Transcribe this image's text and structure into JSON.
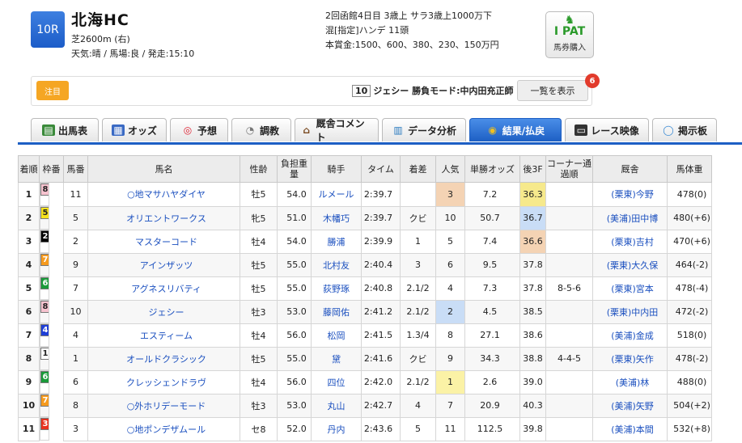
{
  "race": {
    "number": "10R",
    "name": "北海HC",
    "course": "芝2600m (右)",
    "conditions": "天気:晴 / 馬場:良 / 発走:15:10",
    "meta_line1": "2回函館4日目 3歳上 サラ3歳上1000万下",
    "meta_line2": "混[指定]ハンデ 11頭",
    "meta_line3": "本賞金:1500、600、380、230、150万円"
  },
  "ipat": {
    "icon": "horse-rider-icon",
    "title": "I PAT",
    "label": "馬券購入"
  },
  "notice": {
    "tag": "注目",
    "number": "10",
    "text": "ジェシー 勝負モード:中内田充正師",
    "button": "一覧を表示",
    "badge": "6"
  },
  "tabs": [
    {
      "label": "出馬表",
      "icon": "entry-table-icon"
    },
    {
      "label": "オッズ",
      "icon": "odds-chart-icon"
    },
    {
      "label": "予想",
      "icon": "target-icon"
    },
    {
      "label": "調教",
      "icon": "stopwatch-icon"
    },
    {
      "label": "厩舎コメント",
      "icon": "stable-house-icon"
    },
    {
      "label": "データ分析",
      "icon": "bar-chart-icon"
    },
    {
      "label": "結果/払戻",
      "icon": "coins-icon",
      "active": true
    },
    {
      "label": "レース映像",
      "icon": "film-icon"
    },
    {
      "label": "掲示板",
      "icon": "speech-bubble-icon"
    }
  ],
  "columns": [
    "着順",
    "枠番",
    "馬番",
    "馬名",
    "性齢",
    "負担重量",
    "騎手",
    "タイム",
    "着差",
    "人気",
    "単勝オッズ",
    "後3F",
    "コーナー通過順",
    "厩舎",
    "馬体重"
  ],
  "colors": {
    "waku1": "#ffffff",
    "waku2": "#000000",
    "waku3": "#e8311f",
    "waku4": "#1f3fd6",
    "waku5": "#f6e21c",
    "waku6": "#1a9a3a",
    "waku7": "#f59a1e",
    "waku8": "#f7c3cf"
  },
  "rows": [
    {
      "pos": "1",
      "waku": "8",
      "num": "11",
      "horse": "○地マサハヤダイヤ",
      "sex_age": "牡5",
      "weight": "54.0",
      "jockey": "ルメール",
      "time": "2:39.7",
      "margin": "",
      "pop": "3",
      "odds": "7.2",
      "last3f": "36.3",
      "corner": "",
      "trainer": "(栗東)今野",
      "body": "478(0)"
    },
    {
      "pos": "2",
      "waku": "5",
      "num": "5",
      "horse": "オリエントワークス",
      "sex_age": "牝5",
      "weight": "51.0",
      "jockey": "木幡巧",
      "time": "2:39.7",
      "margin": "クビ",
      "pop": "10",
      "odds": "50.7",
      "last3f": "36.7",
      "corner": "",
      "trainer": "(美浦)田中博",
      "body": "480(+6)"
    },
    {
      "pos": "3",
      "waku": "2",
      "num": "2",
      "horse": "マスターコード",
      "sex_age": "牡4",
      "weight": "54.0",
      "jockey": "勝浦",
      "time": "2:39.9",
      "margin": "1",
      "pop": "5",
      "odds": "7.4",
      "last3f": "36.6",
      "corner": "",
      "trainer": "(栗東)吉村",
      "body": "470(+6)"
    },
    {
      "pos": "4",
      "waku": "7",
      "num": "9",
      "horse": "アインザッツ",
      "sex_age": "牡5",
      "weight": "55.0",
      "jockey": "北村友",
      "time": "2:40.4",
      "margin": "3",
      "pop": "6",
      "odds": "9.5",
      "last3f": "37.8",
      "corner": "",
      "trainer": "(栗東)大久保",
      "body": "464(-2)"
    },
    {
      "pos": "5",
      "waku": "6",
      "num": "7",
      "horse": "アグネスリバティ",
      "sex_age": "牡5",
      "weight": "55.0",
      "jockey": "荻野琢",
      "time": "2:40.8",
      "margin": "2.1/2",
      "pop": "4",
      "odds": "7.3",
      "last3f": "37.8",
      "corner": "8-5-6",
      "trainer": "(栗東)宮本",
      "body": "478(-4)"
    },
    {
      "pos": "6",
      "waku": "8",
      "num": "10",
      "horse": "ジェシー",
      "sex_age": "牡3",
      "weight": "53.0",
      "jockey": "藤岡佑",
      "time": "2:41.2",
      "margin": "2.1/2",
      "pop": "2",
      "odds": "4.5",
      "last3f": "38.5",
      "corner": "",
      "trainer": "(栗東)中内田",
      "body": "472(-2)"
    },
    {
      "pos": "7",
      "waku": "4",
      "num": "4",
      "horse": "エスティーム",
      "sex_age": "牡4",
      "weight": "56.0",
      "jockey": "松岡",
      "time": "2:41.5",
      "margin": "1.3/4",
      "pop": "8",
      "odds": "27.1",
      "last3f": "38.6",
      "corner": "",
      "trainer": "(美浦)金成",
      "body": "518(0)"
    },
    {
      "pos": "8",
      "waku": "1",
      "num": "1",
      "horse": "オールドクラシック",
      "sex_age": "牡5",
      "weight": "55.0",
      "jockey": "黛",
      "time": "2:41.6",
      "margin": "クビ",
      "pop": "9",
      "odds": "34.3",
      "last3f": "38.8",
      "corner": "4-4-5",
      "trainer": "(栗東)矢作",
      "body": "478(-2)"
    },
    {
      "pos": "9",
      "waku": "6",
      "num": "6",
      "horse": "クレッシェンドラヴ",
      "sex_age": "牡4",
      "weight": "56.0",
      "jockey": "四位",
      "time": "2:42.0",
      "margin": "2.1/2",
      "pop": "1",
      "odds": "2.6",
      "last3f": "39.0",
      "corner": "",
      "trainer": "(美浦)林",
      "body": "488(0)"
    },
    {
      "pos": "10",
      "waku": "7",
      "num": "8",
      "horse": "○外ホリデーモード",
      "sex_age": "牡3",
      "weight": "53.0",
      "jockey": "丸山",
      "time": "2:42.7",
      "margin": "4",
      "pop": "7",
      "odds": "20.9",
      "last3f": "40.3",
      "corner": "",
      "trainer": "(美浦)矢野",
      "body": "504(+2)"
    },
    {
      "pos": "11",
      "waku": "3",
      "num": "3",
      "horse": "○地ポンデザムール",
      "sex_age": "セ8",
      "weight": "52.0",
      "jockey": "丹内",
      "time": "2:43.6",
      "margin": "5",
      "pop": "11",
      "odds": "112.5",
      "last3f": "39.8",
      "corner": "",
      "trainer": "(美浦)本間",
      "body": "532(+8)"
    }
  ]
}
